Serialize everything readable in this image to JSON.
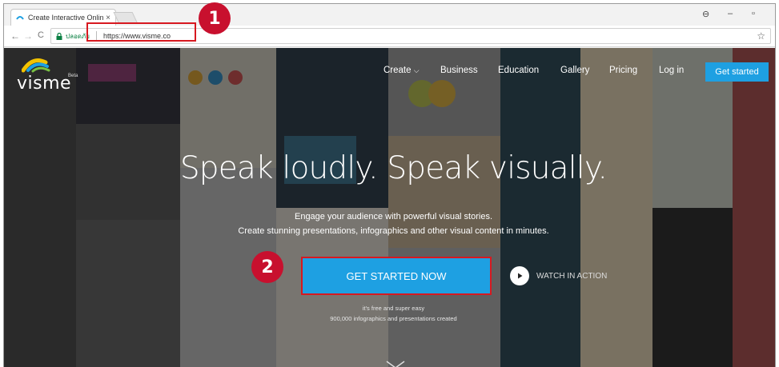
{
  "browser": {
    "tab_title": "Create Interactive Online",
    "tab_close": "×",
    "secure_label": "ปลอดภัย",
    "url": "https://www.visme.co",
    "controls": {
      "account": "⊖",
      "minimize": "–",
      "restore": "▫"
    },
    "nav": {
      "back": "←",
      "forward": "→",
      "reload": "C",
      "bookmark": "☆"
    }
  },
  "site": {
    "logo": {
      "wordmark": "visme",
      "beta": "Beta"
    },
    "nav": {
      "create": "Create",
      "business": "Business",
      "education": "Education",
      "gallery": "Gallery",
      "pricing": "Pricing",
      "login": "Log in",
      "get_started": "Get started"
    },
    "hero": {
      "headline": "Speak loudly. Speak visually.",
      "sub1": "Engage your audience with powerful visual stories.",
      "sub2": "Create stunning presentations, infographics and other visual content in minutes.",
      "cta": "GET STARTED NOW",
      "watch": "WATCH IN ACTION",
      "fine1": "it's free and super easy",
      "fine2": "900,000 infographics and presentations created"
    }
  },
  "annotations": {
    "step1": "1",
    "step2": "2"
  },
  "colors": {
    "accent": "#1ea0e2",
    "highlight": "#d71920",
    "badge": "#c8102e"
  }
}
